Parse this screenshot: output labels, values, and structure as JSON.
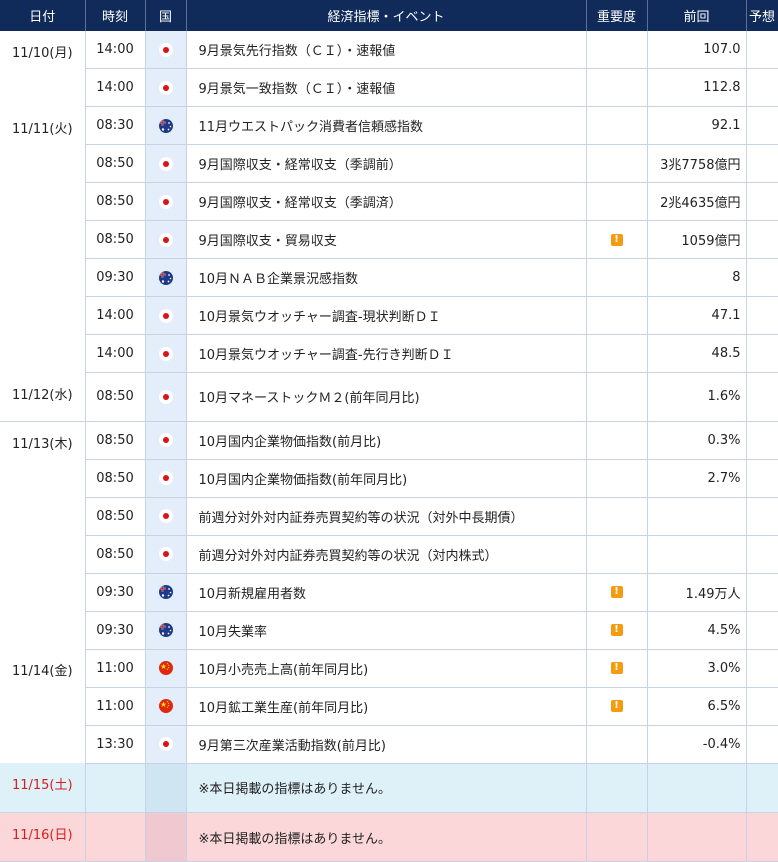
{
  "headers": {
    "date": "日付",
    "time": "時刻",
    "country": "国",
    "event": "経済指標・イベント",
    "importance": "重要度",
    "previous": "前回",
    "forecast": "予想"
  },
  "days": [
    {
      "date": "11/10(月)",
      "date_color": "normal",
      "rows": [
        {
          "time": "14:00",
          "country": "JP",
          "event": "9月景気先行指数（ＣＩ）・速報値",
          "important": false,
          "previous": "107.0"
        },
        {
          "time": "14:00",
          "country": "JP",
          "event": "9月景気一致指数（ＣＩ）・速報値",
          "important": false,
          "previous": "112.8"
        }
      ]
    },
    {
      "date": "11/11(火)",
      "date_color": "normal",
      "rows": [
        {
          "time": "08:30",
          "country": "AU",
          "event": "11月ウエストパック消費者信頼感指数",
          "important": false,
          "previous": "92.1"
        },
        {
          "time": "08:50",
          "country": "JP",
          "event": "9月国際収支・経常収支（季調前）",
          "important": false,
          "previous": "3兆7758億円"
        },
        {
          "time": "08:50",
          "country": "JP",
          "event": "9月国際収支・経常収支（季調済）",
          "important": false,
          "previous": "2兆4635億円"
        },
        {
          "time": "08:50",
          "country": "JP",
          "event": "9月国際収支・貿易収支",
          "important": true,
          "previous": "1059億円"
        },
        {
          "time": "09:30",
          "country": "AU",
          "event": "10月ＮＡＢ企業景況感指数",
          "important": false,
          "previous": "8"
        },
        {
          "time": "14:00",
          "country": "JP",
          "event": "10月景気ウオッチャー調査-現状判断ＤＩ",
          "important": false,
          "previous": "47.1"
        },
        {
          "time": "14:00",
          "country": "JP",
          "event": "10月景気ウオッチャー調査-先行き判断ＤＩ",
          "important": false,
          "previous": "48.5"
        }
      ]
    },
    {
      "date": "11/12(水)",
      "date_color": "normal",
      "rows": [
        {
          "time": "08:50",
          "country": "JP",
          "event": "10月マネーストックＭ２(前年同月比)",
          "important": false,
          "previous": "1.6%"
        }
      ]
    },
    {
      "date": "11/13(木)",
      "date_color": "normal",
      "rows": [
        {
          "time": "08:50",
          "country": "JP",
          "event": "10月国内企業物価指数(前月比)",
          "important": false,
          "previous": "0.3%"
        },
        {
          "time": "08:50",
          "country": "JP",
          "event": "10月国内企業物価指数(前年同月比)",
          "important": false,
          "previous": "2.7%"
        },
        {
          "time": "08:50",
          "country": "JP",
          "event": "前週分対外対内証券売買契約等の状況（対外中長期債）",
          "important": false,
          "previous": ""
        },
        {
          "time": "08:50",
          "country": "JP",
          "event": "前週分対外対内証券売買契約等の状況（対内株式）",
          "important": false,
          "previous": ""
        },
        {
          "time": "09:30",
          "country": "AU",
          "event": "10月新規雇用者数",
          "important": true,
          "previous": "1.49万人"
        },
        {
          "time": "09:30",
          "country": "AU",
          "event": "10月失業率",
          "important": true,
          "previous": "4.5%"
        }
      ]
    },
    {
      "date": "11/14(金)",
      "date_color": "normal",
      "rows": [
        {
          "time": "11:00",
          "country": "CN",
          "event": "10月小売売上高(前年同月比)",
          "important": true,
          "previous": "3.0%"
        },
        {
          "time": "11:00",
          "country": "CN",
          "event": "10月鉱工業生産(前年同月比)",
          "important": true,
          "previous": "6.5%"
        },
        {
          "time": "13:30",
          "country": "JP",
          "event": "9月第三次産業活動指数(前月比)",
          "important": false,
          "previous": "-0.4%"
        }
      ]
    },
    {
      "date": "11/15(土)",
      "date_color": "red",
      "variant": "sat",
      "rows": [
        {
          "time": "",
          "country": "",
          "event": "※本日掲載の指標はありません。",
          "important": false,
          "previous": ""
        }
      ]
    },
    {
      "date": "11/16(日)",
      "date_color": "red",
      "variant": "sun",
      "rows": [
        {
          "time": "",
          "country": "",
          "event": "※本日掲載の指標はありません。",
          "important": false,
          "previous": ""
        }
      ]
    }
  ],
  "importance_icon": {
    "name": "exclamation-icon",
    "glyph": "!",
    "color": "#f39c12"
  },
  "colors": {
    "header_bg": "#102b5a",
    "country_col_bg": "#e4eefa",
    "saturday_bg": "#dff1f8",
    "sunday_bg": "#fbd7d9",
    "weekend_date": "#d41e1e"
  }
}
